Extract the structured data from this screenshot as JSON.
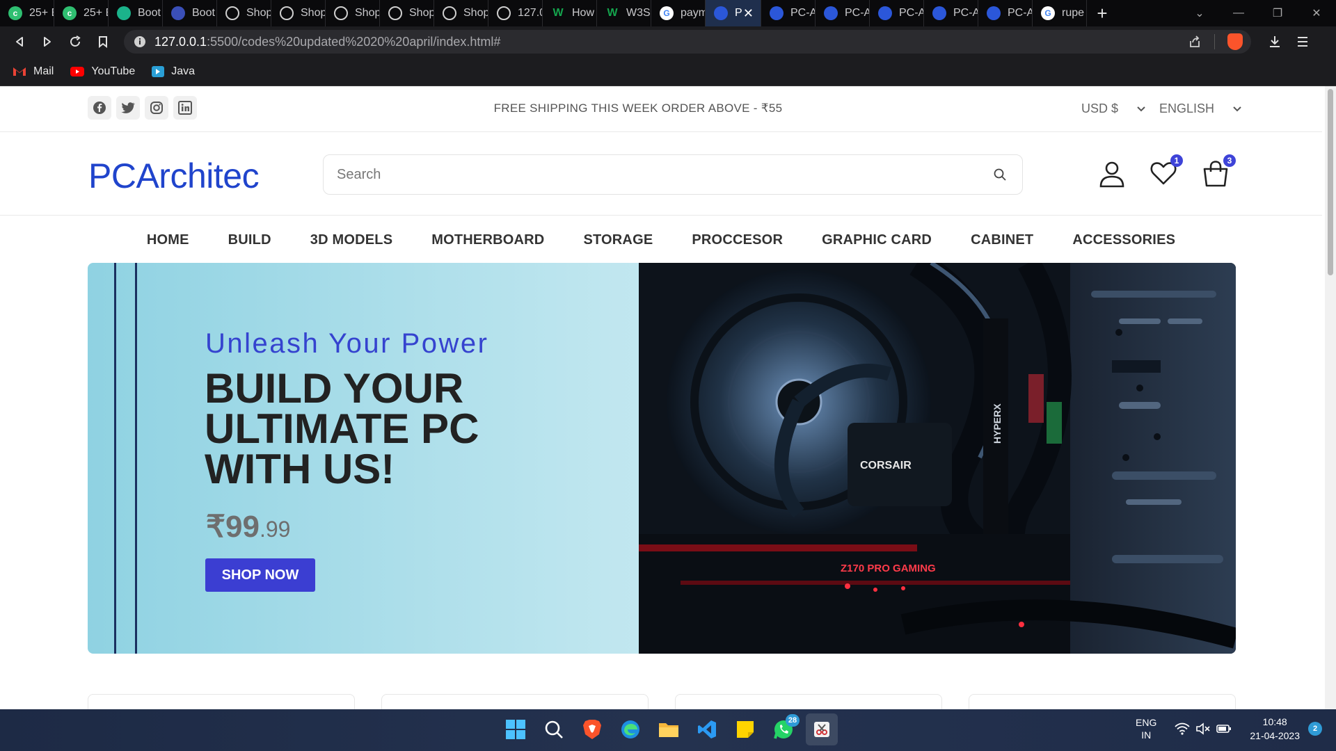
{
  "browser": {
    "tabs": [
      {
        "label": "25+ E",
        "icon": "green-g-icon",
        "color": "#2fbf71"
      },
      {
        "label": "25+ E",
        "icon": "green-g-icon",
        "color": "#2fbf71"
      },
      {
        "label": "Boot",
        "icon": "bootstrap-icon",
        "color": "#1bb38b"
      },
      {
        "label": "Boot",
        "icon": "bootstrap-grid-icon",
        "color": "#3a4fb8"
      },
      {
        "label": "Shop",
        "icon": "globe-icon",
        "color": "#9a9a9a"
      },
      {
        "label": "Shop",
        "icon": "globe-icon",
        "color": "#9a9a9a"
      },
      {
        "label": "Shop",
        "icon": "globe-icon",
        "color": "#9a9a9a"
      },
      {
        "label": "Shop",
        "icon": "globe-icon",
        "color": "#9a9a9a"
      },
      {
        "label": "Shop",
        "icon": "globe-icon",
        "color": "#9a9a9a"
      },
      {
        "label": "127.0",
        "icon": "globe-icon",
        "color": "#9a9a9a"
      },
      {
        "label": "How",
        "icon": "w-icon",
        "color": "#14a44d"
      },
      {
        "label": "W3S",
        "icon": "w-icon",
        "color": "#14a44d"
      },
      {
        "label": "paym",
        "icon": "google-icon",
        "color": "#ffffff"
      },
      {
        "label": "P",
        "icon": "pc-icon",
        "color": "#2b57d9",
        "active": true
      },
      {
        "label": "PC-A",
        "icon": "pc-icon",
        "color": "#2b57d9"
      },
      {
        "label": "PC-A",
        "icon": "pc-icon",
        "color": "#2b57d9"
      },
      {
        "label": "PC-A",
        "icon": "pc-icon",
        "color": "#2b57d9"
      },
      {
        "label": "PC-A",
        "icon": "pc-icon",
        "color": "#2b57d9"
      },
      {
        "label": "PC-A",
        "icon": "pc-icon",
        "color": "#2b57d9"
      },
      {
        "label": "rupe",
        "icon": "google-icon",
        "color": "#ffffff"
      }
    ],
    "url_host": "127.0.0.1",
    "url_path": ":5500/codes%20updated%2020%20april/index.html#",
    "bookmarks": [
      {
        "label": "Mail",
        "color": "#ea4335"
      },
      {
        "label": "YouTube",
        "color": "#ff0000"
      },
      {
        "label": "Java",
        "color": "#2a9fd6"
      }
    ]
  },
  "topbar": {
    "shipping": "FREE SHIPPING THIS WEEK ORDER ABOVE - ₹55",
    "currency": "USD $",
    "language": "ENGLISH"
  },
  "header": {
    "logo": "PCArchitec",
    "search_placeholder": "Search",
    "wishlist_count": "1",
    "cart_count": "3"
  },
  "nav": [
    "HOME",
    "BUILD",
    "3D MODELS",
    "MOTHERBOARD",
    "STORAGE",
    "PROCCESOR",
    "GRAPHIC CARD",
    "CABINET",
    "ACCESSORIES"
  ],
  "hero": {
    "kicker": "Unleash Your Power",
    "headline": "BUILD YOUR ULTIMATE PC WITH US!",
    "price_main": "₹99",
    "price_cents": ".99",
    "button": "SHOP NOW",
    "photo_text_1": "CORSAIR",
    "photo_text_2": "HYPERX",
    "photo_text_3": "Z170 PRO GAMING"
  },
  "taskbar": {
    "whatsapp_badge": "28",
    "lang_1": "ENG",
    "lang_2": "IN",
    "time": "10:48",
    "date": "21-04-2023",
    "notifications": "2"
  },
  "colors": {
    "accent": "#3b3ed2",
    "logo": "#2044cc",
    "badge": "#3e43d8"
  }
}
